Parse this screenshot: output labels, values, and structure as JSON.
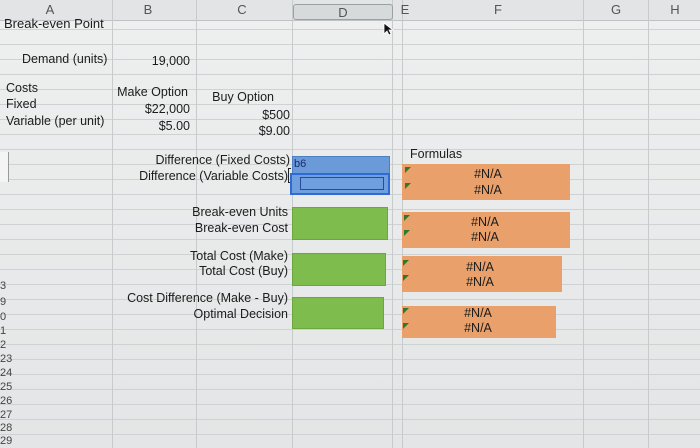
{
  "columns": [
    "A",
    "B",
    "C",
    "D",
    "E",
    "F",
    "G",
    "H"
  ],
  "row_numbers": [
    "3",
    "9",
    "0",
    "1",
    "2",
    "23",
    "24",
    "25",
    "26",
    "27",
    "28",
    "29"
  ],
  "title": "Break-even Point",
  "demand": {
    "label": "Demand (units)",
    "value": "19,000"
  },
  "costs": {
    "label": "Costs",
    "fixed_label": "Fixed",
    "variable_label": "Variable (per unit)",
    "make_header": "Make Option",
    "make_fixed": "$22,000",
    "make_variable": "$5.00",
    "buy_header": "Buy Option",
    "buy_fixed": "$500",
    "buy_variable": "$9.00"
  },
  "differences": {
    "fixed_label": "Difference (Fixed Costs)",
    "variable_label": "Difference (Variable Costs)",
    "cell_ref_tag": "b6"
  },
  "breakeven": {
    "units_label": "Break-even Units",
    "cost_label": "Break-even Cost"
  },
  "totals": {
    "make_label": "Total Cost (Make)",
    "buy_label": "Total Cost (Buy)"
  },
  "decision": {
    "diff_label": "Cost Difference (Make - Buy)",
    "optimal_label": "Optimal Decision"
  },
  "formulas": {
    "header": "Formulas",
    "values": [
      "#N/A",
      "#N/A",
      "#N/A",
      "#N/A",
      "#N/A",
      "#N/A",
      "#N/A",
      "#N/A"
    ]
  },
  "colors": {
    "green": "#7ebd4d",
    "orange": "#e9a06a",
    "blue": "#6a9ad8",
    "triangle": "#2f7a2a"
  }
}
